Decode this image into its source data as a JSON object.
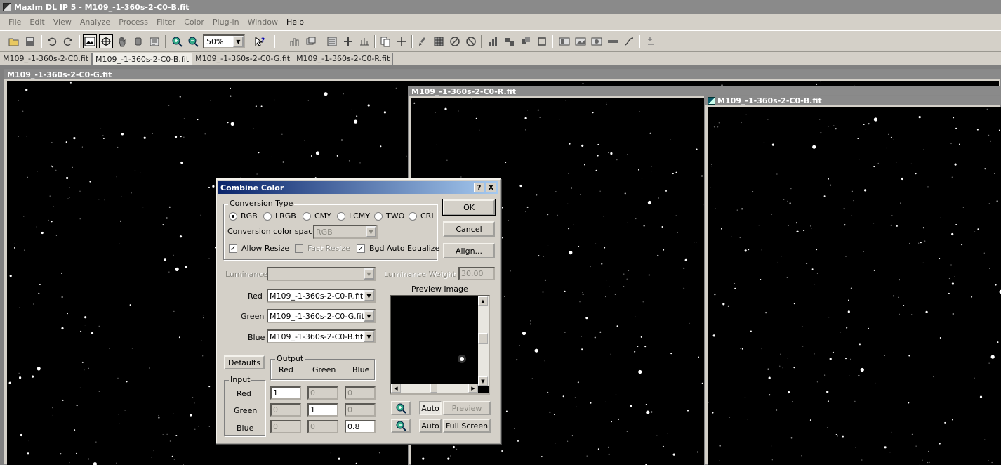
{
  "app": {
    "title": "MaxIm DL IP 5 - M109_-1-360s-2-C0-B.fit"
  },
  "menu": [
    "File",
    "Edit",
    "View",
    "Analyze",
    "Process",
    "Filter",
    "Color",
    "Plug-in",
    "Window",
    "Help"
  ],
  "toolbar": {
    "zoom": "50%"
  },
  "tabs": [
    "M109_-1-360s-2-C0.fit",
    "M109_-1-360s-2-C0-B.fit",
    "M109_-1-360s-2-C0-G.fit",
    "M109_-1-360s-2-C0-R.fit"
  ],
  "windows": {
    "g": "M109_-1-360s-2-C0-G.fit",
    "r": "M109_-1-360s-2-C0-R.fit",
    "b": "M109_-1-360s-2-C0-B.fit"
  },
  "dialog": {
    "title": "Combine Color",
    "help_button": "?",
    "close_button": "X",
    "conversion_type_label": "Conversion Type",
    "types": [
      "RGB",
      "LRGB",
      "CMY",
      "LCMY",
      "TWO",
      "CRI"
    ],
    "selected_type": "RGB",
    "color_space_label": "Conversion color space",
    "color_space_value": "RGB",
    "allow_resize": "Allow Resize",
    "fast_resize": "Fast Resize",
    "bgd_auto_equalize": "Bgd Auto Equalize",
    "ok": "OK",
    "cancel": "Cancel",
    "align": "Align...",
    "luminance_label": "Luminance",
    "luminance_weight_label": "Luminance Weight %",
    "luminance_weight_value": "30.00",
    "red_label": "Red",
    "green_label": "Green",
    "blue_label": "Blue",
    "red_file": "M109_-1-360s-2-C0-R.fit",
    "green_file": "M109_-1-360s-2-C0-G.fit",
    "blue_file": "M109_-1-360s-2-C0-B.fit",
    "preview_label": "Preview Image",
    "defaults": "Defaults",
    "output_label": "Output",
    "input_label": "Input",
    "output_cols": [
      "Red",
      "Green",
      "Blue"
    ],
    "input_rows": [
      "Red",
      "Green",
      "Blue"
    ],
    "matrix": [
      [
        "1",
        "0",
        "0"
      ],
      [
        "0",
        "1",
        "0"
      ],
      [
        "0",
        "0",
        "0.8"
      ]
    ],
    "auto1": "Auto",
    "preview_btn": "Preview",
    "auto2": "Auto",
    "full_screen": "Full Screen"
  }
}
